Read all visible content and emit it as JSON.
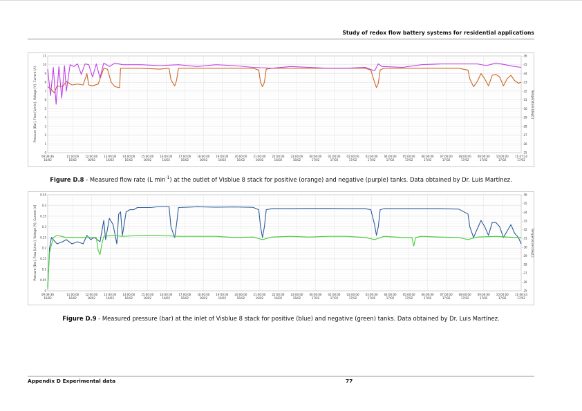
{
  "running_header": "Study of redox flow battery systems for residential applications",
  "footer": {
    "left": "Appendix D Experimental data",
    "page_number": "77"
  },
  "figures": [
    {
      "id": "D.8",
      "label": "Figure D.8",
      "caption_pre": " - Measured flow rate (L min",
      "caption_sup": "-1",
      "caption_post": ") at the outlet of Visblue 8 stack for positive (orange) and negative (purple) tanks. Data obtained by Dr. Luis Martínez."
    },
    {
      "id": "D.9",
      "label": "Figure D.9",
      "caption_text": " - Measured pressure (bar) at the inlet of Visblue 8 stack for positive (blue) and negative (green) tanks. Data obtained by Dr. Luis Martínez."
    }
  ],
  "chart_data": [
    {
      "type": "line",
      "id": "flow-rate-chart",
      "title": "",
      "ylabel": "Pressure [Bar], Flow [L/min], Voltage [V], Current [A]",
      "ylabel_right": "Temperature [degC]",
      "ylim": [
        0,
        11
      ],
      "yticks": [
        0,
        1,
        2,
        3,
        4,
        5,
        6,
        7,
        8,
        9,
        10,
        11
      ],
      "ylim_right": [
        25,
        36
      ],
      "yticks_right": [
        25,
        26,
        27,
        28,
        29,
        30,
        31,
        32,
        33,
        34,
        35,
        36
      ],
      "xlim": [
        0,
        25.35
      ],
      "xtick_labels": [
        [
          "09:39:36",
          "16/02"
        ],
        [
          "11:00:00",
          "16/02"
        ],
        [
          "12:00:00",
          "16/02"
        ],
        [
          "13:00:00",
          "16/02"
        ],
        [
          "14:00:00",
          "16/02"
        ],
        [
          "15:00:00",
          "16/02"
        ],
        [
          "16:00:00",
          "16/02"
        ],
        [
          "17:00:00",
          "16/02"
        ],
        [
          "18:00:00",
          "16/02"
        ],
        [
          "19:00:00",
          "16/02"
        ],
        [
          "20:00:00",
          "16/02"
        ],
        [
          "21:00:00",
          "16/02"
        ],
        [
          "22:00:00",
          "16/02"
        ],
        [
          "23:00:00",
          "16/02"
        ],
        [
          "00:00:00",
          "17/02"
        ],
        [
          "01:00:00",
          "17/02"
        ],
        [
          "02:00:00",
          "17/02"
        ],
        [
          "03:00:00",
          "17/02"
        ],
        [
          "04:00:00",
          "17/02"
        ],
        [
          "05:00:00",
          "17/02"
        ],
        [
          "06:00:00",
          "17/02"
        ],
        [
          "07:00:00",
          "17/02"
        ],
        [
          "08:00:00",
          "17/02"
        ],
        [
          "09:00:00",
          "17/02"
        ],
        [
          "10:00:00",
          "17/02"
        ],
        [
          "11:07:24",
          "17/02"
        ]
      ],
      "xtick_values": [
        0,
        1.34,
        2.34,
        3.34,
        4.34,
        5.34,
        6.34,
        7.34,
        8.34,
        9.34,
        10.34,
        11.34,
        12.34,
        13.34,
        14.34,
        15.34,
        16.34,
        17.34,
        18.34,
        19.34,
        20.34,
        21.34,
        22.34,
        23.34,
        24.34,
        25.35
      ],
      "series": [
        {
          "color": "#cc6622",
          "x": [
            0,
            0.2,
            0.35,
            0.5,
            0.8,
            1.0,
            1.3,
            1.6,
            1.9,
            2.1,
            2.2,
            2.4,
            2.7,
            3.0,
            3.2,
            3.4,
            3.6,
            3.85,
            3.9,
            4.0,
            4.4,
            5.0,
            6.0,
            6.5,
            6.6,
            6.8,
            6.9,
            7.0,
            8.0,
            9.0,
            10.0,
            11.0,
            11.3,
            11.4,
            11.5,
            11.6,
            11.7,
            12.0,
            13.0,
            14.0,
            15.0,
            16.0,
            17.0,
            17.3,
            17.5,
            17.6,
            17.7,
            17.8,
            18.0,
            19.0,
            20.0,
            21.0,
            22.0,
            22.5,
            22.6,
            22.8,
            23.0,
            23.2,
            23.4,
            23.6,
            23.8,
            24.0,
            24.2,
            24.4,
            24.6,
            24.8,
            25.0,
            25.2,
            25.35
          ],
          "values": [
            7.5,
            7.2,
            6.8,
            7.6,
            7.5,
            8.1,
            7.7,
            7.8,
            7.7,
            9.0,
            7.7,
            7.6,
            7.8,
            9.6,
            9.5,
            8.0,
            7.5,
            7.4,
            9.6,
            9.6,
            9.6,
            9.6,
            9.5,
            9.6,
            8.3,
            7.6,
            8.2,
            9.6,
            9.6,
            9.6,
            9.6,
            9.6,
            9.4,
            8.0,
            7.5,
            8.0,
            9.5,
            9.6,
            9.6,
            9.6,
            9.6,
            9.6,
            9.6,
            9.4,
            8.0,
            7.4,
            7.9,
            9.4,
            9.6,
            9.6,
            9.6,
            9.6,
            9.6,
            9.4,
            8.4,
            7.5,
            8.1,
            9.0,
            8.4,
            7.6,
            8.8,
            8.9,
            8.6,
            7.6,
            8.4,
            8.8,
            8.2,
            7.9,
            8.0
          ]
        },
        {
          "color": "#c040e8",
          "x": [
            0,
            0.15,
            0.3,
            0.45,
            0.6,
            0.75,
            0.9,
            1.0,
            1.2,
            1.4,
            1.6,
            1.8,
            2.0,
            2.2,
            2.4,
            2.6,
            2.8,
            3.0,
            3.3,
            3.6,
            4.0,
            5.0,
            6.0,
            7.0,
            8.0,
            9.0,
            10.0,
            11.0,
            12.0,
            13.0,
            14.0,
            15.0,
            16.0,
            17.0,
            17.5,
            17.7,
            17.9,
            18.0,
            19.0,
            20.0,
            21.0,
            22.0,
            23.0,
            23.5,
            24.0,
            24.5,
            25.0,
            25.35
          ],
          "values": [
            9.5,
            6.5,
            9.7,
            5.5,
            9.8,
            6.2,
            9.9,
            7.0,
            10.0,
            9.8,
            10.1,
            8.9,
            10.1,
            10.0,
            8.6,
            10.1,
            8.5,
            10.2,
            9.8,
            10.2,
            10.0,
            10.0,
            9.9,
            10.0,
            9.8,
            10.0,
            9.9,
            9.7,
            9.6,
            9.8,
            9.7,
            9.6,
            9.6,
            9.7,
            9.3,
            10.1,
            9.8,
            9.8,
            9.7,
            10.0,
            10.1,
            10.1,
            10.1,
            9.9,
            10.2,
            10.0,
            9.8,
            9.7
          ]
        }
      ]
    },
    {
      "type": "line",
      "id": "pressure-chart",
      "title": "",
      "ylabel": "Pressure [Bar], Flow [L/min], Voltage [V], Current [A]",
      "ylabel_right": "Temperature [degC]",
      "ylim": [
        0,
        0.45
      ],
      "yticks": [
        0,
        0.05,
        0.1,
        0.15,
        0.2,
        0.25,
        0.3,
        0.35,
        0.4,
        0.45
      ],
      "ytick_labels": [
        "0",
        "0.05",
        "0.1",
        "0.15",
        "0.2",
        "0.25",
        "0.3",
        "0.35",
        "0.4",
        "0.45"
      ],
      "ylim_right": [
        25,
        36
      ],
      "yticks_right": [
        25,
        26,
        27,
        28,
        29,
        30,
        31,
        32,
        33,
        34,
        35,
        36
      ],
      "xlim": [
        0,
        25.35
      ],
      "xtick_labels": [
        [
          "09:39:36",
          "16/02"
        ],
        [
          "11:00:00",
          "16/02"
        ],
        [
          "12:00:00",
          "16/02"
        ],
        [
          "13:00:00",
          "16/02"
        ],
        [
          "14:00:00",
          "16/02"
        ],
        [
          "15:00:00",
          "16/02"
        ],
        [
          "16:00:00",
          "16/02"
        ],
        [
          "17:00:00",
          "16/02"
        ],
        [
          "18:00:00",
          "16/02"
        ],
        [
          "19:00:00",
          "16/02"
        ],
        [
          "20:00:00",
          "16/02"
        ],
        [
          "21:00:00",
          "16/02"
        ],
        [
          "22:00:00",
          "16/02"
        ],
        [
          "23:00:00",
          "16/02"
        ],
        [
          "00:00:00",
          "17/02"
        ],
        [
          "01:00:00",
          "17/02"
        ],
        [
          "02:00:00",
          "17/02"
        ],
        [
          "03:00:00",
          "17/02"
        ],
        [
          "04:00:00",
          "17/02"
        ],
        [
          "05:00:00",
          "17/02"
        ],
        [
          "06:00:00",
          "17/02"
        ],
        [
          "07:00:00",
          "17/02"
        ],
        [
          "08:00:00",
          "17/02"
        ],
        [
          "09:00:00",
          "17/02"
        ],
        [
          "10:00:00",
          "17/02"
        ],
        [
          "11:06:43",
          "17/02"
        ]
      ],
      "xtick_values": [
        0,
        1.34,
        2.34,
        3.34,
        4.34,
        5.34,
        6.34,
        7.34,
        8.34,
        9.34,
        10.34,
        11.34,
        12.34,
        13.34,
        14.34,
        15.34,
        16.34,
        17.34,
        18.34,
        19.34,
        20.34,
        21.34,
        22.34,
        23.34,
        24.34,
        25.35
      ],
      "series": [
        {
          "color": "#2a5a9a",
          "x": [
            0,
            0.1,
            0.2,
            0.3,
            0.5,
            0.8,
            1.0,
            1.3,
            1.6,
            1.9,
            2.1,
            2.3,
            2.5,
            2.8,
            3.0,
            3.1,
            3.3,
            3.5,
            3.7,
            3.8,
            3.9,
            4.0,
            4.2,
            4.4,
            4.6,
            4.8,
            5.0,
            5.5,
            6.0,
            6.5,
            6.6,
            6.8,
            6.9,
            7.0,
            7.5,
            8.0,
            9.0,
            10.0,
            11.0,
            11.3,
            11.4,
            11.5,
            11.6,
            11.7,
            12.0,
            13.0,
            14.0,
            15.0,
            16.0,
            17.0,
            17.3,
            17.5,
            17.6,
            17.7,
            17.8,
            18.0,
            19.0,
            20.0,
            21.0,
            22.0,
            22.5,
            22.6,
            22.8,
            23.0,
            23.2,
            23.4,
            23.6,
            23.8,
            24.0,
            24.2,
            24.4,
            24.6,
            24.8,
            25.0,
            25.2,
            25.35
          ],
          "values": [
            0.01,
            0.2,
            0.25,
            0.24,
            0.22,
            0.23,
            0.24,
            0.22,
            0.23,
            0.22,
            0.26,
            0.24,
            0.25,
            0.23,
            0.33,
            0.24,
            0.34,
            0.31,
            0.22,
            0.36,
            0.37,
            0.26,
            0.37,
            0.38,
            0.38,
            0.39,
            0.39,
            0.39,
            0.395,
            0.395,
            0.3,
            0.25,
            0.31,
            0.39,
            0.392,
            0.394,
            0.392,
            0.393,
            0.391,
            0.38,
            0.3,
            0.25,
            0.3,
            0.38,
            0.385,
            0.385,
            0.386,
            0.386,
            0.385,
            0.385,
            0.38,
            0.31,
            0.26,
            0.3,
            0.38,
            0.385,
            0.385,
            0.385,
            0.385,
            0.383,
            0.36,
            0.3,
            0.25,
            0.29,
            0.33,
            0.3,
            0.26,
            0.32,
            0.32,
            0.3,
            0.25,
            0.28,
            0.31,
            0.27,
            0.25,
            0.22
          ]
        },
        {
          "color": "#44cc33",
          "x": [
            0,
            0.1,
            0.3,
            0.5,
            1.0,
            2.0,
            2.6,
            2.7,
            2.8,
            2.9,
            3.0,
            3.5,
            4.0,
            5.0,
            6.0,
            7.0,
            8.0,
            9.0,
            10.0,
            11.0,
            11.5,
            12.0,
            13.0,
            14.0,
            15.0,
            16.0,
            17.0,
            17.5,
            18.0,
            19.0,
            19.5,
            19.6,
            19.7,
            20.0,
            21.0,
            22.0,
            22.5,
            23.0,
            24.0,
            25.0,
            25.35
          ],
          "values": [
            0.01,
            0.18,
            0.25,
            0.26,
            0.25,
            0.25,
            0.25,
            0.19,
            0.17,
            0.22,
            0.255,
            0.26,
            0.255,
            0.26,
            0.26,
            0.255,
            0.255,
            0.255,
            0.25,
            0.252,
            0.24,
            0.252,
            0.255,
            0.252,
            0.255,
            0.255,
            0.25,
            0.24,
            0.255,
            0.25,
            0.25,
            0.21,
            0.25,
            0.255,
            0.252,
            0.25,
            0.24,
            0.252,
            0.255,
            0.25,
            0.25
          ]
        }
      ]
    }
  ]
}
